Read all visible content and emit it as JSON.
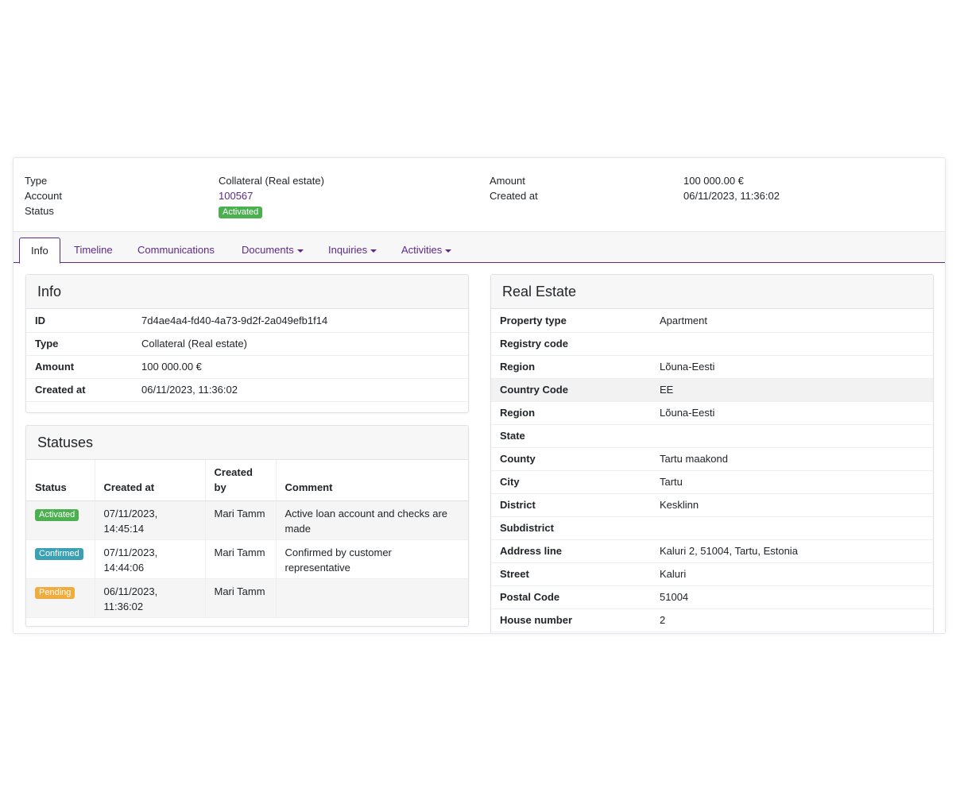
{
  "summary": {
    "type_label": "Type",
    "type_value": "Collateral (Real estate)",
    "account_label": "Account",
    "account_value": "100567",
    "status_label": "Status",
    "status_value": "Activated",
    "amount_label": "Amount",
    "amount_value": "100 000.00 €",
    "created_label": "Created at",
    "created_value": "06/11/2023, 11:36:02"
  },
  "tabs": [
    {
      "label": "Info",
      "active": true
    },
    {
      "label": "Timeline"
    },
    {
      "label": "Communications"
    },
    {
      "label": "Documents",
      "dropdown": true
    },
    {
      "label": "Inquiries",
      "dropdown": true
    },
    {
      "label": "Activities",
      "dropdown": true
    }
  ],
  "info": {
    "title": "Info",
    "rows": [
      {
        "k": "ID",
        "v": "7d4ae4a4-fd40-4a73-9d2f-2a049efb1f14"
      },
      {
        "k": "Type",
        "v": "Collateral (Real estate)"
      },
      {
        "k": "Amount",
        "v": "100 000.00 €"
      },
      {
        "k": "Created at",
        "v": "06/11/2023, 11:36:02"
      }
    ]
  },
  "statuses": {
    "title": "Statuses",
    "headers": [
      "Status",
      "Created at",
      "Created by",
      "Comment"
    ],
    "rows": [
      {
        "status": "Activated",
        "created_at": "07/11/2023, 14:45:14",
        "created_by": "Mari Tamm",
        "comment": "Active loan account and checks are made"
      },
      {
        "status": "Confirmed",
        "created_at": "07/11/2023, 14:44:06",
        "created_by": "Mari Tamm",
        "comment": "Confirmed by customer representative"
      },
      {
        "status": "Pending",
        "created_at": "06/11/2023, 11:36:02",
        "created_by": "Mari Tamm",
        "comment": ""
      }
    ]
  },
  "real_estate": {
    "title": "Real Estate",
    "rows": [
      {
        "k": "Property type",
        "v": "Apartment"
      },
      {
        "k": "Registry code",
        "v": ""
      },
      {
        "k": "Region",
        "v": "Lõuna-Eesti"
      },
      {
        "k": "Country Code",
        "v": "EE"
      },
      {
        "k": "Region",
        "v": "Lõuna-Eesti"
      },
      {
        "k": "State",
        "v": ""
      },
      {
        "k": "County",
        "v": "Tartu maakond"
      },
      {
        "k": "City",
        "v": "Tartu"
      },
      {
        "k": "District",
        "v": "Kesklinn"
      },
      {
        "k": "Subdistrict",
        "v": ""
      },
      {
        "k": "Address line",
        "v": "Kaluri 2, 51004, Tartu, Estonia"
      },
      {
        "k": "Street",
        "v": "Kaluri"
      },
      {
        "k": "Postal Code",
        "v": "51004"
      },
      {
        "k": "House number",
        "v": "2"
      }
    ]
  },
  "colors": {
    "accent": "#5b2a86",
    "badge_activated": "#4caf50",
    "badge_confirmed": "#3aa0b4",
    "badge_pending": "#f0ad3d"
  }
}
